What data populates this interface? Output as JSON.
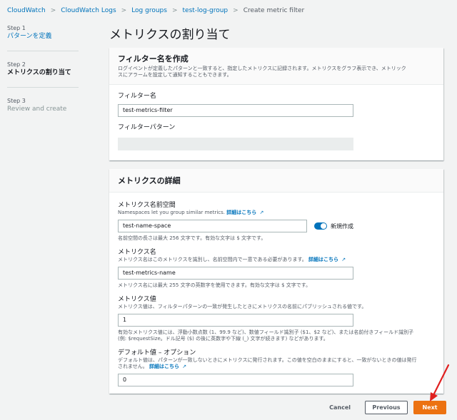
{
  "breadcrumb": [
    "CloudWatch",
    "CloudWatch Logs",
    "Log groups",
    "test-log-group",
    "Create metric filter"
  ],
  "steps": [
    {
      "num": "Step 1",
      "label": "パターンを定義"
    },
    {
      "num": "Step 2",
      "label": "メトリクスの割り当て"
    },
    {
      "num": "Step 3",
      "label": "Review and create"
    }
  ],
  "page_title": "メトリクスの割り当て",
  "filter_panel": {
    "title": "フィルター名を作成",
    "desc1": "ログイベントが定義したパターンと一致すると、指定したメトリクスに記録されます。メトリクスをグラフ表示でき、メトリック",
    "desc2": "スにアラームを設定して通知することもできます。",
    "name_label": "フィルター名",
    "name_value": "test-metrics-filter",
    "pattern_label": "フィルターパターン",
    "pattern_value": ""
  },
  "metric_panel": {
    "title": "メトリクスの詳細",
    "namespace_label": "メトリクス名前空間",
    "namespace_desc": "Namespaces let you group similar metrics.",
    "learn_more": "詳細はこちら",
    "namespace_value": "test-name-space",
    "new_toggle_label": "新規作成",
    "namespace_hint": "名前空間の長さは最大 256 文字です。有効な文字は $ 文字です。",
    "name_label": "メトリクス名",
    "name_desc": "メトリクス名はこのメトリクスを識別し、名前空間内で一意である必要があります。",
    "name_value": "test-metrics-name",
    "name_hint": "メトリクス名には最大 255 文字の英数字を使用できます。有効な文字は $ 文字です。",
    "value_label": "メトリクス値",
    "value_desc": "メトリクス値は、フィルターパターンの一致が発生したときにメトリクスの名前にパブリッシュされる値です。",
    "value_value": "1",
    "value_hint1": "有効なメトリクス値には、浮動小数点数 (1、99.9 など)、数値フィールド識別子 ($1、$2 など)、または名前付きフィールド識別子",
    "value_hint2": "(例: $requestSize。ドル記号 ($) の後に英数字や下線 (_) 文字が続きます) などがあります。",
    "default_label": "デフォルト値 – オプション",
    "default_desc1": "デフォルト値は、パターンが一致しないときにメトリクスに発行されます。この値を空白のままにすると、一致がないときの値は発行",
    "default_desc2": "されません。",
    "default_value": "0"
  },
  "footer": {
    "cancel": "Cancel",
    "previous": "Previous",
    "next": "Next"
  },
  "colors": {
    "accent": "#ec7211",
    "link": "#0073bb",
    "annotation": "#e02020"
  }
}
